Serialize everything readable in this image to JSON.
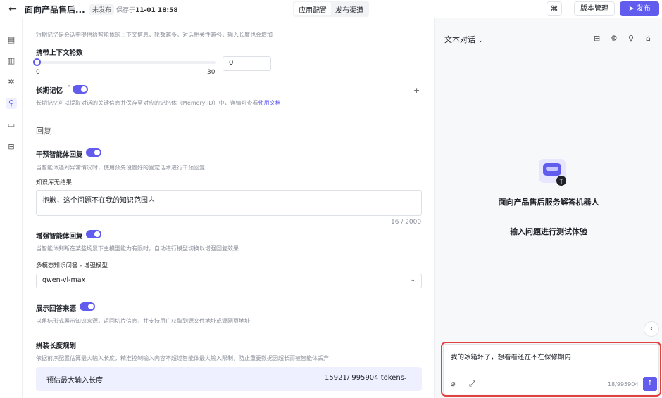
{
  "topbar": {
    "back_icon": "arrow-left-icon",
    "title": "面向产品售后...",
    "badge": "未发布",
    "saved_prefix": "保存于",
    "saved_time": "11-01 18:58",
    "tabs": [
      {
        "label": "应用配置",
        "active": true
      },
      {
        "label": "发布渠道",
        "active": false
      }
    ],
    "grid_icon": "grid-icon",
    "version_label": "版本管理",
    "publish_label": "发布"
  },
  "rail": {
    "items": [
      "document-icon",
      "file-icon",
      "sparkle-icon",
      "bulb-icon",
      "chat-icon",
      "bag-icon"
    ],
    "active_index": 3
  },
  "config": {
    "memory_hint": "短期记忆是会话中提供给智能体的上下文信息，轮数越多，对话相关性越强，输入长度也会增加",
    "context_rounds_label": "携带上下文轮数",
    "slider_min": "0",
    "slider_max": "30",
    "context_rounds_value": "0",
    "long_memory_label": "长期记忆",
    "long_memory_hint": "长期记忆可以提取对话的关键信息并保存至对应的记忆体（Memory ID）中，详情可查看",
    "doc_link": "使用文档",
    "reply_section": "回复",
    "intervene_label": "干预智能体回复",
    "intervene_hint": "当智能体遇到异常情况时，使用预先设置好的固定话术进行干预回复",
    "no_result_label": "知识库无结果",
    "no_result_text": "抱歉，这个问题不在我的知识范围内",
    "no_result_count": "16 / 2000",
    "enhance_label": "增强智能体回复",
    "enhance_hint": "当智能体判断在某些场景下主模型能力有限时，自动进行模型切换以增强回复效果",
    "multimodal_label": "多模态知识问答 - 增强模型",
    "model_value": "qwen-vl-max",
    "source_label": "展示回答来源",
    "source_hint": "以角标形式展示知识来源，返回切片信息，并支持用户获取到源文件地址或源网页地址",
    "length_label": "拼装长度规划",
    "length_hint": "依据前序配置估算最大输入长度，精准控制输入内容不超过智能体最大输入限制，防止重要数据因超长而被智能体丢弃",
    "estimate_label": "预估最大输入长度",
    "estimate_value": "15921/ 995904 tokens"
  },
  "chat": {
    "mode_label": "文本对话",
    "bot_name": "面向产品售后服务解答机器人",
    "bot_hint": "输入问题进行测试体验",
    "input_text": "我的冰箱坏了，想看看还在不在保修期内",
    "counter": "18/995904",
    "header_icons": [
      "bag-icon",
      "gear-icon",
      "bulb-icon",
      "clean-icon"
    ]
  },
  "colors": {
    "accent": "#615ced",
    "highlight": "#e0433f"
  }
}
